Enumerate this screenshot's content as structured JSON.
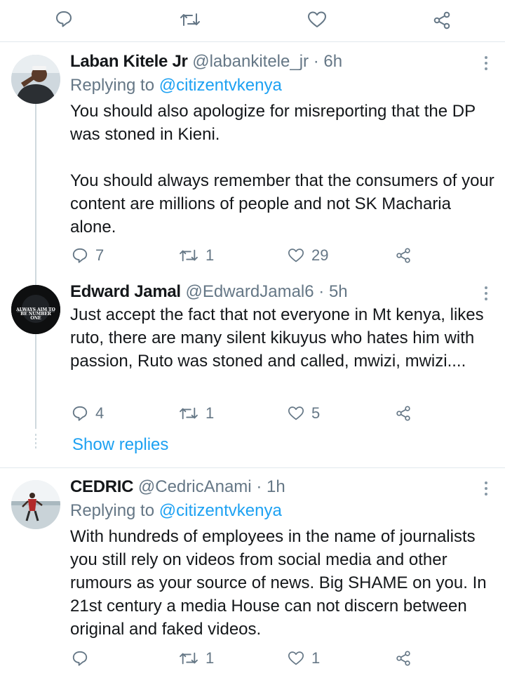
{
  "top_actions": {},
  "tweets": [
    {
      "name": "Laban Kitele Jr",
      "handle": "@labankitele_jr",
      "sep": "·",
      "time": "6h",
      "replying_prefix": "Replying to ",
      "replying_to": "@citizentvkenya",
      "paragraphs": [
        "You should also apologize for misreporting that the DP was stoned in Kieni.",
        "You should always remember that the consumers of your content are millions of people and not SK Macharia alone."
      ],
      "replies": "7",
      "retweets": "1",
      "likes": "29"
    },
    {
      "name": "Edward Jamal",
      "handle": "@EdwardJamal6",
      "sep": "·",
      "time": "5h",
      "avatar_text": "ALWAYS AIM TO BE NUMBER ONE",
      "paragraphs": [
        "Just accept the fact that not everyone in Mt kenya, likes ruto, there are many silent kikuyus who hates him with passion, Ruto was stoned and called, mwizi, mwizi...."
      ],
      "replies": "4",
      "retweets": "1",
      "likes": "5",
      "show_replies": "Show replies"
    },
    {
      "name": "CEDRIC",
      "handle": "@CedricAnami",
      "sep": "·",
      "time": "1h",
      "replying_prefix": "Replying to ",
      "replying_to": "@citizentvkenya",
      "paragraphs": [
        "With hundreds of employees in the name of journalists you still rely on videos from social media and other rumours as your source of news. Big SHAME on you. In 21st century a media House can not discern between original and faked videos."
      ],
      "replies": "",
      "retweets": "1",
      "likes": "1"
    }
  ],
  "colors": {
    "text": "#14171a",
    "muted": "#657786",
    "accent": "#1da1f2",
    "divider": "#e1e8ed"
  },
  "icons": [
    "reply-icon",
    "retweet-icon",
    "like-icon",
    "share-icon",
    "more-icon"
  ]
}
